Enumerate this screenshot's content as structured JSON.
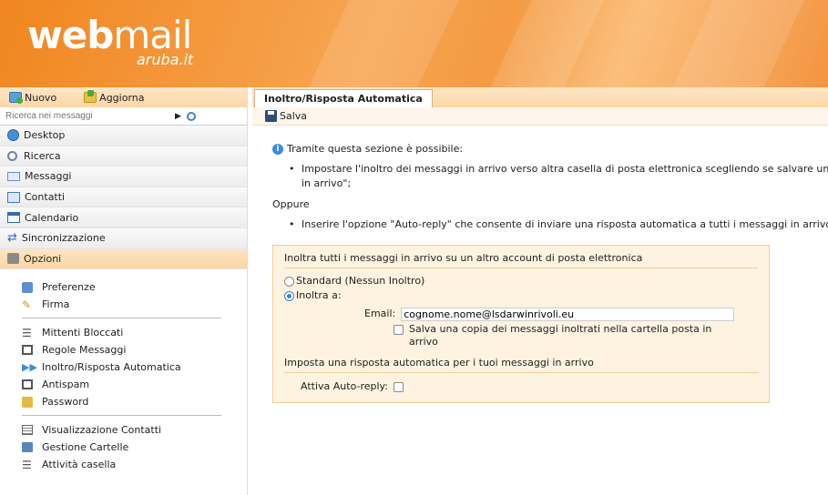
{
  "logo": {
    "main_bold": "web",
    "main_light": "mail",
    "sub": "aruba.it"
  },
  "sidebar": {
    "actions": [
      {
        "label": "Nuovo"
      },
      {
        "label": "Aggiorna"
      }
    ],
    "search_placeholder": "Ricerca nei messaggi",
    "nav": [
      {
        "label": "Desktop"
      },
      {
        "label": "Ricerca"
      },
      {
        "label": "Messaggi"
      },
      {
        "label": "Contatti"
      },
      {
        "label": "Calendario"
      },
      {
        "label": "Sincronizzazione"
      },
      {
        "label": "Opzioni"
      }
    ],
    "options_group1": [
      {
        "label": "Preferenze"
      },
      {
        "label": "Firma"
      }
    ],
    "options_group2": [
      {
        "label": "Mittenti Bloccati"
      },
      {
        "label": "Regole Messaggi"
      },
      {
        "label": "Inoltro/Risposta Automatica"
      },
      {
        "label": "Antispam"
      },
      {
        "label": "Password"
      }
    ],
    "options_group3": [
      {
        "label": "Visualizzazione Contatti"
      },
      {
        "label": "Gestione Cartelle"
      },
      {
        "label": "Attività casella"
      }
    ]
  },
  "main": {
    "tab": "Inoltro/Risposta Automatica",
    "save_label": "Salva",
    "intro": "Tramite questa sezione è possibile:",
    "bullet1_line1": "Impostare l'inoltro dei messaggi in arrivo verso altra casella di posta elettronica scegliendo se salvare una co",
    "bullet1_line2": "in arrivo\";",
    "oppure": "Oppure",
    "bullet2": "Inserire l'opzione \"Auto-reply\" che consente di inviare una risposta automatica a tutti i messaggi in arrivo du",
    "panel": {
      "forward_heading": "Inoltra tutti i messaggi in arrivo su un altro account di posta elettronica",
      "radio_standard": "Standard (Nessun Inoltro)",
      "radio_forward": "Inoltra a:",
      "email_label": "Email:",
      "email_value": "cognome.nome@lsdarwinrivoli.eu",
      "save_copy_label": "Salva una copia dei messaggi inoltrati nella cartella posta in arrivo",
      "autoreply_heading": "Imposta una risposta automatica per i tuoi messaggi in arrivo",
      "autoreply_label": "Attiva Auto-reply:"
    }
  }
}
